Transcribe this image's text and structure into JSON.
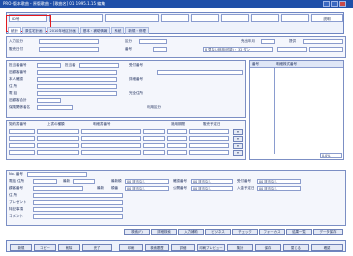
{
  "window": {
    "title": "PRO-版本歌曲・原版歌曲・[歌曲名] 01 1995.1.15 編集"
  },
  "topbar": {
    "highlighted_item": "ID号",
    "cells": [
      "",
      "",
      "",
      "",
      "",
      "",
      "",
      "",
      ""
    ],
    "right_label": "説明"
  },
  "tabs": [
    "統計",
    "原住宅計画",
    "2010年地区計画",
    "基本・補助情報",
    "系統",
    "新規・修理"
  ],
  "upper_form": {
    "labels": [
      "入力区分",
      "販売日付",
      "区分",
      "番号",
      "売出年月",
      "提供"
    ],
    "values": [
      "",
      "",
      "",
      "",
      "",
      "",
      "",
      "",
      ""
    ],
    "extra": "8 見ない利用(可能)・ 32 ダン"
  },
  "middle_form": {
    "labels": [
      "担当者番号",
      "担当者",
      "受付番号",
      "取引条件"
    ],
    "left_col": [
      "旧顧客番号",
      "本人確認",
      "住 所",
      "電 話",
      "旧顧客合計",
      "保険関係者名"
    ],
    "right_col": [
      "詳細番号",
      "完全住所",
      "利用区分"
    ]
  },
  "middle_table": {
    "headers": [
      "契約書番号",
      "上書の種類",
      "明細書番号",
      "適用期間",
      "販売予定日"
    ],
    "rows": [
      [
        "",
        "",
        "",
        "",
        "",
        "",
        "",
        "",
        "",
        "",
        "",
        ""
      ],
      [
        "",
        "",
        "",
        "",
        "",
        "",
        "",
        "",
        "",
        "",
        "",
        ""
      ]
    ]
  },
  "sidebar_grid": {
    "headers": [
      "番号",
      "明細株式番号"
    ],
    "footer_value": "0.0%"
  },
  "lower_form": {
    "labels": [
      "No. 番号",
      "電話 住所",
      "顧客番号",
      "住 所",
      "プレゼント",
      "特記事項",
      "コメント"
    ],
    "chips": [
      "最新",
      "最新順",
      "最新",
      "順番",
      "確認番号",
      "受付番号",
      "公開番号",
      "入金予定日"
    ],
    "selects": [
      "00 該当なし",
      "00 該当なし",
      "00 該当なし",
      "00 該当なし",
      "00 該当なし",
      "00 該当なし"
    ]
  },
  "toolbar2": [
    "検索(F)",
    "詳細検索",
    "入力補助",
    "ビジネス",
    "チェック",
    "フォーカス",
    "結果一覧",
    "データ保存"
  ],
  "bottombar": [
    "新規",
    "コピー",
    "削除",
    "完了",
    "印刷",
    "検索履歴",
    "詳細",
    "印刷プレビュー",
    "集計",
    "保存",
    "閉じる",
    "確認"
  ]
}
